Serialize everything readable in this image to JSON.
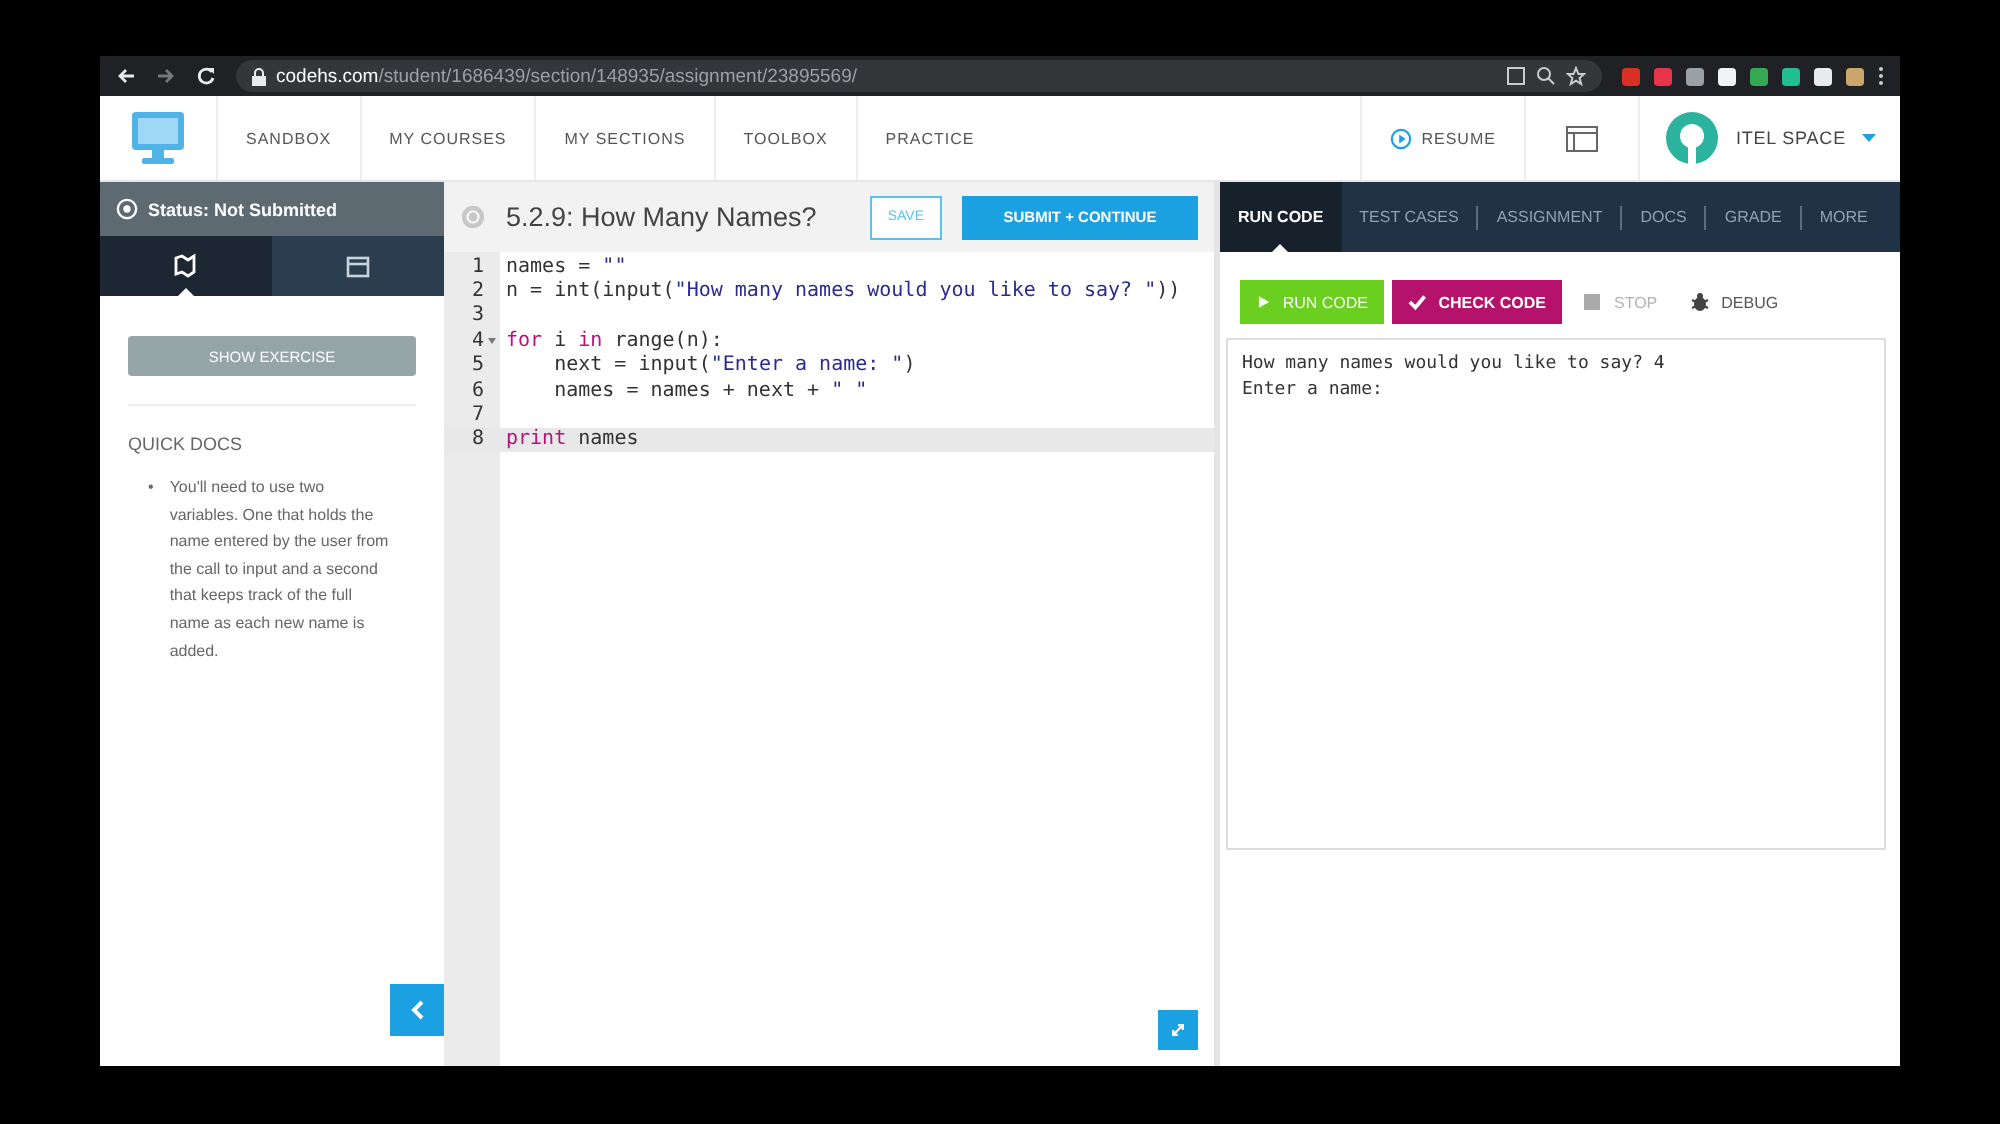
{
  "browser": {
    "url": "**codehs.com**/student/1686439/section/148935/assignment/23895569/",
    "extensions": [
      {
        "color": "#d93025"
      },
      {
        "color": "#e8344a"
      },
      {
        "color": "#9aa0a6"
      },
      {
        "color": "#f1f3f4"
      },
      {
        "color": "#34a853"
      },
      {
        "color": "#1fbf8f"
      },
      {
        "color": "#e8eaed"
      },
      {
        "color": "#c9a66b"
      }
    ]
  },
  "nav": {
    "items": [
      {
        "label": "SANDBOX"
      },
      {
        "label": "MY COURSES"
      },
      {
        "label": "MY SECTIONS"
      },
      {
        "label": "TOOLBOX"
      },
      {
        "label": "PRACTICE"
      }
    ],
    "resume": "RESUME",
    "user": "ITEL SPACE"
  },
  "sidebar": {
    "status": "Status: Not Submitted",
    "tabs": [
      {
        "kind": "map",
        "selected": true
      },
      {
        "kind": "calendar",
        "selected": false
      }
    ],
    "show_exercise": "SHOW EXERCISE",
    "docs_title": "QUICK DOCS",
    "docs": [
      {
        "bullet": "•",
        "text": "You'll need to use two variables. One that holds the name entered by the user from the call to input and a second that keeps track of the full name as each new name is added."
      }
    ]
  },
  "editor": {
    "title": "5.2.9: How Many Names?",
    "save": "SAVE",
    "submit": "SUBMIT + CONTINUE",
    "lines": [
      {
        "number": "1",
        "foldable": false,
        "active": false,
        "tokens": [
          {
            "text": "names = ",
            "kind": "plain"
          },
          {
            "text": "\"\"",
            "kind": "string"
          }
        ]
      },
      {
        "number": "2",
        "foldable": false,
        "active": false,
        "tokens": [
          {
            "text": "n = int(input(",
            "kind": "plain"
          },
          {
            "text": "\"How many names would you like to say? \"",
            "kind": "string"
          },
          {
            "text": "))",
            "kind": "plain"
          }
        ]
      },
      {
        "number": "3",
        "foldable": false,
        "active": false
      },
      {
        "number": "4",
        "foldable": true,
        "active": false,
        "tokens": [
          {
            "text": "for",
            "kind": "keyword"
          },
          {
            "text": " i ",
            "kind": "plain"
          },
          {
            "text": "in",
            "kind": "keyword"
          },
          {
            "text": " range(n):",
            "kind": "plain"
          }
        ]
      },
      {
        "number": "5",
        "foldable": false,
        "active": false,
        "tokens": [
          {
            "text": "    next = input(",
            "kind": "plain"
          },
          {
            "text": "\"Enter a name: \"",
            "kind": "string"
          },
          {
            "text": ")",
            "kind": "plain"
          }
        ]
      },
      {
        "number": "6",
        "foldable": false,
        "active": false,
        "tokens": [
          {
            "text": "    names = names + next + ",
            "kind": "plain"
          },
          {
            "text": "\" \"",
            "kind": "string"
          }
        ]
      },
      {
        "number": "7",
        "foldable": false,
        "active": false
      },
      {
        "number": "8",
        "foldable": false,
        "active": true,
        "tokens": [
          {
            "text": "print",
            "kind": "keyword"
          },
          {
            "text": " names",
            "kind": "plain"
          }
        ]
      }
    ]
  },
  "panel": {
    "tabs": [
      {
        "label": "RUN CODE",
        "selected": true
      },
      {
        "label": "TEST CASES",
        "selected": false
      },
      {
        "label": "ASSIGNMENT",
        "selected": false
      },
      {
        "label": "DOCS",
        "selected": false
      },
      {
        "label": "GRADE",
        "selected": false
      },
      {
        "label": "MORE",
        "selected": false
      }
    ],
    "actions": [
      {
        "kind": "run",
        "label": "RUN CODE",
        "disabled": false
      },
      {
        "kind": "check",
        "label": "CHECK CODE",
        "disabled": false
      },
      {
        "kind": "stop",
        "label": "STOP",
        "disabled": true
      },
      {
        "kind": "debug",
        "label": "DEBUG",
        "disabled": false
      }
    ],
    "console": [
      "How many names would you like to say? 4",
      "Enter a name:"
    ]
  }
}
